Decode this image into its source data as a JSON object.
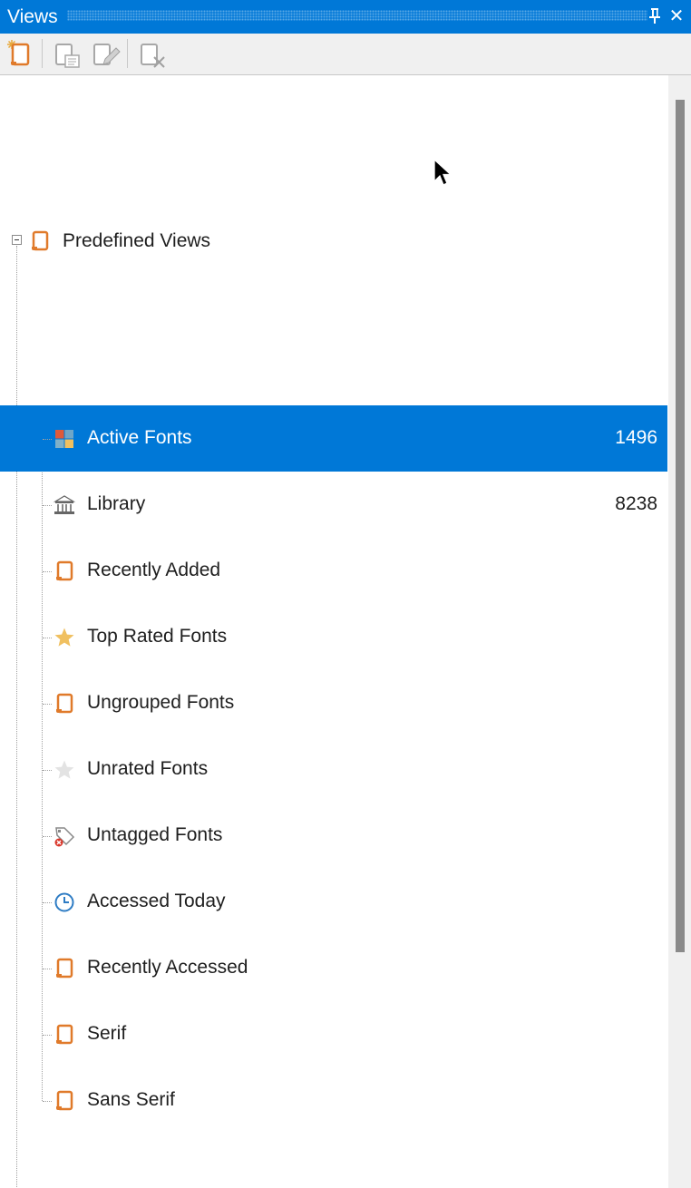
{
  "panel": {
    "title": "Views",
    "pin_icon": "pin-icon",
    "close_icon": "close-icon",
    "close_glyph": "✕"
  },
  "toolbar": {
    "buttons": [
      {
        "name": "new-view-button",
        "icon": "new-view-icon",
        "enabled": true
      },
      {
        "name": "view-properties-button",
        "icon": "view-properties-icon",
        "enabled": false
      },
      {
        "name": "edit-view-button",
        "icon": "edit-view-icon",
        "enabled": false
      },
      {
        "name": "delete-view-button",
        "icon": "delete-view-icon",
        "enabled": false
      }
    ]
  },
  "tree": {
    "root": {
      "label": "Predefined Views",
      "icon": "view-folder-icon",
      "expanded": true
    },
    "items": [
      {
        "label": "Active Fonts",
        "count": "1496",
        "icon": "active-fonts-icon",
        "selected": true
      },
      {
        "label": "Library",
        "count": "8238",
        "icon": "library-icon",
        "selected": false
      },
      {
        "label": "Recently Added",
        "count": "",
        "icon": "view-icon",
        "selected": false
      },
      {
        "label": "Top Rated Fonts",
        "count": "",
        "icon": "star-icon",
        "selected": false
      },
      {
        "label": "Ungrouped Fonts",
        "count": "",
        "icon": "view-icon",
        "selected": false
      },
      {
        "label": "Unrated Fonts",
        "count": "",
        "icon": "empty-star-icon",
        "selected": false
      },
      {
        "label": "Untagged Fonts",
        "count": "",
        "icon": "untagged-icon",
        "selected": false
      },
      {
        "label": "Accessed Today",
        "count": "",
        "icon": "clock-icon",
        "selected": false
      },
      {
        "label": "Recently Accessed",
        "count": "",
        "icon": "view-icon",
        "selected": false
      },
      {
        "label": "Serif",
        "count": "",
        "icon": "view-icon",
        "selected": false
      },
      {
        "label": "Sans Serif",
        "count": "",
        "icon": "view-icon",
        "selected": false
      }
    ]
  },
  "colors": {
    "accent": "#0078d7",
    "view_icon_orange": "#e07a2a",
    "star_gold": "#f0c060"
  }
}
